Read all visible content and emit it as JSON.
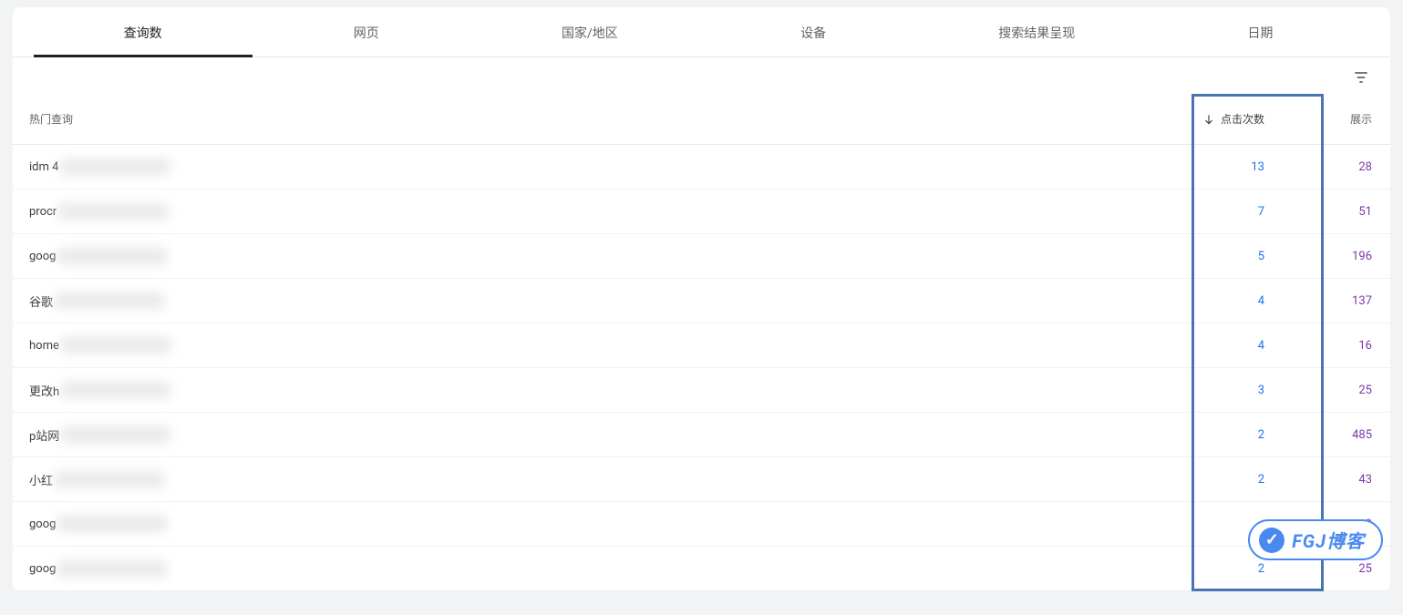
{
  "tabs": [
    {
      "label": "查询数",
      "active": true
    },
    {
      "label": "网页",
      "active": false
    },
    {
      "label": "国家/地区",
      "active": false
    },
    {
      "label": "设备",
      "active": false
    },
    {
      "label": "搜索结果呈现",
      "active": false
    },
    {
      "label": "日期",
      "active": false
    }
  ],
  "columns": {
    "query": "热门查询",
    "clicks": "点击次数",
    "impressions": "展示"
  },
  "sort_indicator": "↓",
  "rows": [
    {
      "query_prefix": "idm 4",
      "clicks": "13",
      "impressions": "28"
    },
    {
      "query_prefix": "procr",
      "clicks": "7",
      "impressions": "51"
    },
    {
      "query_prefix": "goog",
      "clicks": "5",
      "impressions": "196"
    },
    {
      "query_prefix": "谷歌",
      "clicks": "4",
      "impressions": "137"
    },
    {
      "query_prefix": "home",
      "clicks": "4",
      "impressions": "16"
    },
    {
      "query_prefix": "更改h",
      "clicks": "3",
      "impressions": "25"
    },
    {
      "query_prefix": "p站网",
      "clicks": "2",
      "impressions": "485"
    },
    {
      "query_prefix": "小红",
      "clicks": "2",
      "impressions": "43"
    },
    {
      "query_prefix": "goog",
      "clicks": "",
      "impressions": "9"
    },
    {
      "query_prefix": "goog",
      "clicks": "2",
      "impressions": "25"
    }
  ],
  "watermark": {
    "text": "FGJ博客",
    "icon_glyph": "✓"
  }
}
